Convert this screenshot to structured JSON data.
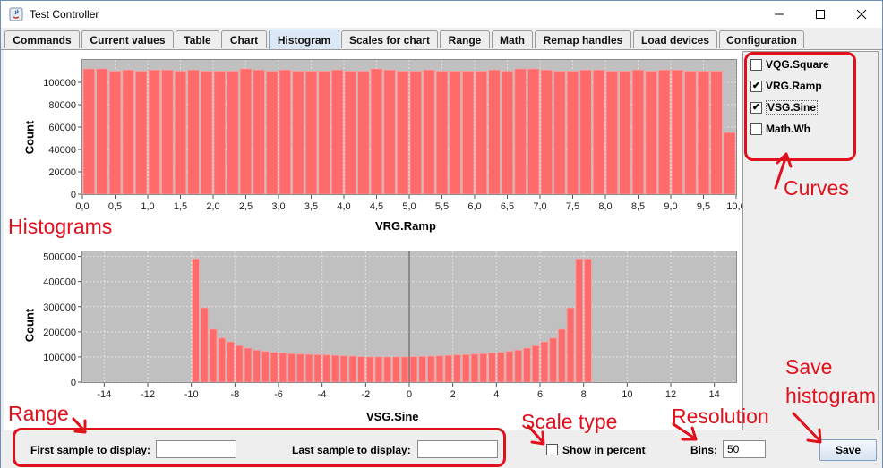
{
  "window": {
    "title": "Test Controller"
  },
  "tabs": [
    {
      "label": "Commands",
      "active": false
    },
    {
      "label": "Current values",
      "active": false
    },
    {
      "label": "Table",
      "active": false
    },
    {
      "label": "Chart",
      "active": false
    },
    {
      "label": "Histogram",
      "active": true
    },
    {
      "label": "Scales for chart",
      "active": false
    },
    {
      "label": "Range",
      "active": false
    },
    {
      "label": "Math",
      "active": false
    },
    {
      "label": "Remap handles",
      "active": false
    },
    {
      "label": "Load devices",
      "active": false
    },
    {
      "label": "Configuration",
      "active": false
    }
  ],
  "histograms": [
    {
      "ylabel": "Count",
      "xlabel": "VRG.Ramp",
      "xlim": [
        0,
        10
      ],
      "ylim": [
        0,
        120000
      ],
      "xticks": [
        "0,0",
        "0,5",
        "1,0",
        "1,5",
        "2,0",
        "2,5",
        "3,0",
        "3,5",
        "4,0",
        "4,5",
        "5,0",
        "5,5",
        "6,0",
        "6,5",
        "7,0",
        "7,5",
        "8,0",
        "8,5",
        "9,0",
        "9,5",
        "10,0"
      ],
      "yticks": [
        "0",
        "20000",
        "40000",
        "60000",
        "80000",
        "100000"
      ],
      "bin_start": 0,
      "bin_width": 0.2,
      "values": [
        112000,
        112000,
        110000,
        111000,
        110000,
        111000,
        111000,
        110000,
        111000,
        110000,
        110000,
        110000,
        112000,
        111000,
        110000,
        111000,
        110000,
        110000,
        110000,
        111000,
        110000,
        110000,
        112000,
        111000,
        110000,
        110000,
        111000,
        110000,
        110000,
        110000,
        110000,
        111000,
        110000,
        112000,
        112000,
        111000,
        110000,
        110000,
        111000,
        111000,
        110000,
        110000,
        111000,
        110000,
        111000,
        111000,
        110000,
        110000,
        110000,
        55000
      ]
    },
    {
      "ylabel": "Count",
      "xlabel": "VSG.Sine",
      "xlim": [
        -15,
        15
      ],
      "ylim": [
        0,
        520000
      ],
      "xticks": [
        "-14",
        "-12",
        "-10",
        "-8",
        "-6",
        "-4",
        "-2",
        "0",
        "2",
        "4",
        "6",
        "8",
        "10",
        "12",
        "14"
      ],
      "yticks": [
        "0",
        "100000",
        "200000",
        "300000",
        "400000",
        "500000"
      ],
      "bin_start": -10,
      "bin_width": 0.4,
      "values": [
        490000,
        295000,
        210000,
        175000,
        160000,
        145000,
        135000,
        127000,
        122000,
        118000,
        116000,
        113000,
        111000,
        110000,
        109000,
        108000,
        106000,
        104000,
        103000,
        101000,
        100000,
        100000,
        100000,
        100000,
        100000,
        101000,
        102000,
        103000,
        104000,
        106000,
        108000,
        109000,
        111000,
        113000,
        116000,
        118000,
        122000,
        127000,
        135000,
        145000,
        160000,
        175000,
        210000,
        295000,
        490000,
        490000
      ]
    }
  ],
  "curves": [
    {
      "label": "VQG.Square",
      "checked": false
    },
    {
      "label": "VRG.Ramp",
      "checked": true
    },
    {
      "label": "VSG.Sine",
      "checked": true
    },
    {
      "label": "Math.Wh",
      "checked": false
    }
  ],
  "bottom": {
    "first_sample_label": "First sample to display:",
    "first_sample_value": "",
    "last_sample_label": "Last sample to display:",
    "last_sample_value": "",
    "show_percent_label": "Show in percent",
    "show_percent_checked": false,
    "bins_label": "Bins:",
    "bins_value": "50",
    "save_label": "Save"
  },
  "annotations": {
    "curves": "Curves",
    "histograms": "Histograms",
    "range": "Range",
    "scale_type": "Scale type",
    "resolution": "Resolution",
    "save_line1": "Save",
    "save_line2": "histogram"
  },
  "colors": {
    "bar": "#ff6a6a",
    "bar_edge": "#ff9a9a",
    "plot_bg": "#c0c0c0",
    "annotation": "#e0101c",
    "active_tab": "#dce8f5"
  }
}
